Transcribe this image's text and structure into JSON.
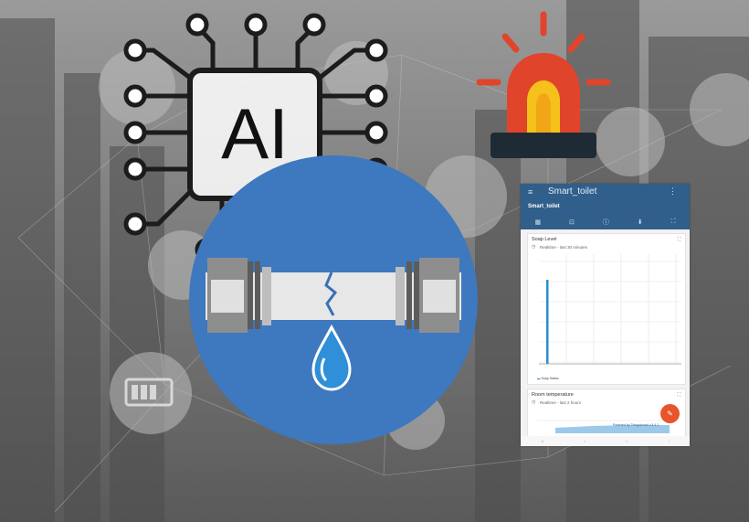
{
  "ai_chip": {
    "label": "AI"
  },
  "app": {
    "title": "Smart_toilet",
    "subtitle": "Smart_toilet",
    "menu_icon": "hamburger-icon",
    "more_icon": "more-vert-icon",
    "tabs": [
      "▦",
      "⊡",
      "ⓘ",
      "⬇",
      "⛶"
    ],
    "cards": [
      {
        "title": "Soap Level",
        "subtitle": "Realtime - last 30 minutes",
        "legend": "Soap Status"
      },
      {
        "title": "Room temperature",
        "subtitle": "Realtime - last 2 hours"
      }
    ],
    "fab_icon": "pencil-icon",
    "fab_glyph": "✎",
    "powered_by": "Powered by Thingsboard v.3.4.1",
    "nav": [
      "◁",
      "○",
      "□",
      "↓"
    ]
  },
  "colors": {
    "pipe_circle": "#3e78bf",
    "water": "#2f8fd8",
    "alarm_red": "#e0452b",
    "alarm_yellow": "#f4c21b",
    "app_bar": "#2f5f8a"
  }
}
